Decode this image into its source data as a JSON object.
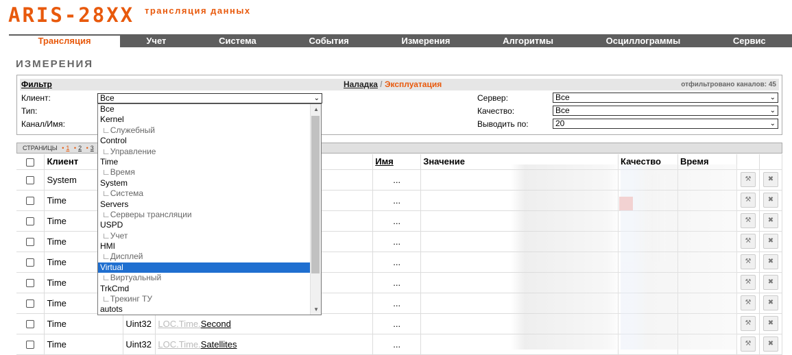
{
  "header": {
    "brand": "ARIS-28XX",
    "subtitle": "трансляция данных"
  },
  "nav": {
    "tabs": [
      {
        "label": "Трансляция",
        "active": true
      },
      {
        "label": "Учет"
      },
      {
        "label": "Система"
      },
      {
        "label": "События"
      },
      {
        "label": "Измерения"
      },
      {
        "label": "Алгоритмы"
      },
      {
        "label": "Осциллограммы"
      },
      {
        "label": "Сервис"
      }
    ]
  },
  "page_title": "ИЗМЕРЕНИЯ",
  "filter": {
    "title": "Фильтр",
    "mode_debug": "Наладка",
    "mode_sep": "/",
    "mode_exploit": "Эксплуатация",
    "count_text": "отфильтровано каналов: 45",
    "client_label": "Клиент:",
    "client_value": "Все",
    "type_label": "Тип:",
    "channel_label": "Канал/Имя:",
    "server_label": "Сервер:",
    "server_value": "Все",
    "quality_label": "Качество:",
    "quality_value": "Все",
    "perpage_label": "Выводить по:",
    "perpage_value": "20"
  },
  "pages": {
    "label": "СТРАНИЦЫ",
    "items": [
      "1",
      "2",
      "3"
    ]
  },
  "table": {
    "headers": {
      "client": "Клиент",
      "name": "Имя",
      "value": "Значение",
      "quality": "Качество",
      "time": "Время"
    },
    "rows": [
      {
        "client": "System",
        "type": "",
        "prefix": "",
        "channel": "",
        "name": "..."
      },
      {
        "client": "Time",
        "type": "",
        "prefix": "",
        "channel": "",
        "name": "..."
      },
      {
        "client": "Time",
        "type": "",
        "prefix": "",
        "channel": "",
        "name": "..."
      },
      {
        "client": "Time",
        "type": "",
        "prefix": "",
        "channel": "",
        "name": "..."
      },
      {
        "client": "Time",
        "type": "",
        "prefix": "",
        "channel": "",
        "name": "..."
      },
      {
        "client": "Time",
        "type": "",
        "prefix": "",
        "channel": "",
        "name": "..."
      },
      {
        "client": "Time",
        "type": "",
        "prefix": "",
        "channel": "",
        "name": "..."
      },
      {
        "client": "Time",
        "type": "Uint32",
        "prefix": "LOC.Time.",
        "channel": "Second",
        "name": "..."
      },
      {
        "client": "Time",
        "type": "Uint32",
        "prefix": "LOC.Time.",
        "channel": "Satellites",
        "name": "..."
      }
    ]
  },
  "dropdown": {
    "options": [
      {
        "label": "Все"
      },
      {
        "label": "Kernel"
      },
      {
        "label": "∟Служебный",
        "child": true
      },
      {
        "label": "Control"
      },
      {
        "label": "∟Управление",
        "child": true
      },
      {
        "label": "Time"
      },
      {
        "label": "∟Время",
        "child": true
      },
      {
        "label": "System"
      },
      {
        "label": "∟Система",
        "child": true
      },
      {
        "label": "Servers"
      },
      {
        "label": "∟Серверы трансляции",
        "child": true
      },
      {
        "label": "USPD"
      },
      {
        "label": "∟Учет",
        "child": true
      },
      {
        "label": "HMI"
      },
      {
        "label": "∟Дисплей",
        "child": true
      },
      {
        "label": "Virtual",
        "selected": true
      },
      {
        "label": "∟Виртуальный",
        "child": true
      },
      {
        "label": "TrkCmd"
      },
      {
        "label": "∟Трекинг ТУ",
        "child": true
      },
      {
        "label": "autots"
      }
    ]
  },
  "icons": {
    "edit": "wrench-icon",
    "delete": "close-icon"
  },
  "colors": {
    "accent": "#e8590c",
    "nav_bg": "#5e5e5e",
    "selected": "#1f6fd0"
  }
}
